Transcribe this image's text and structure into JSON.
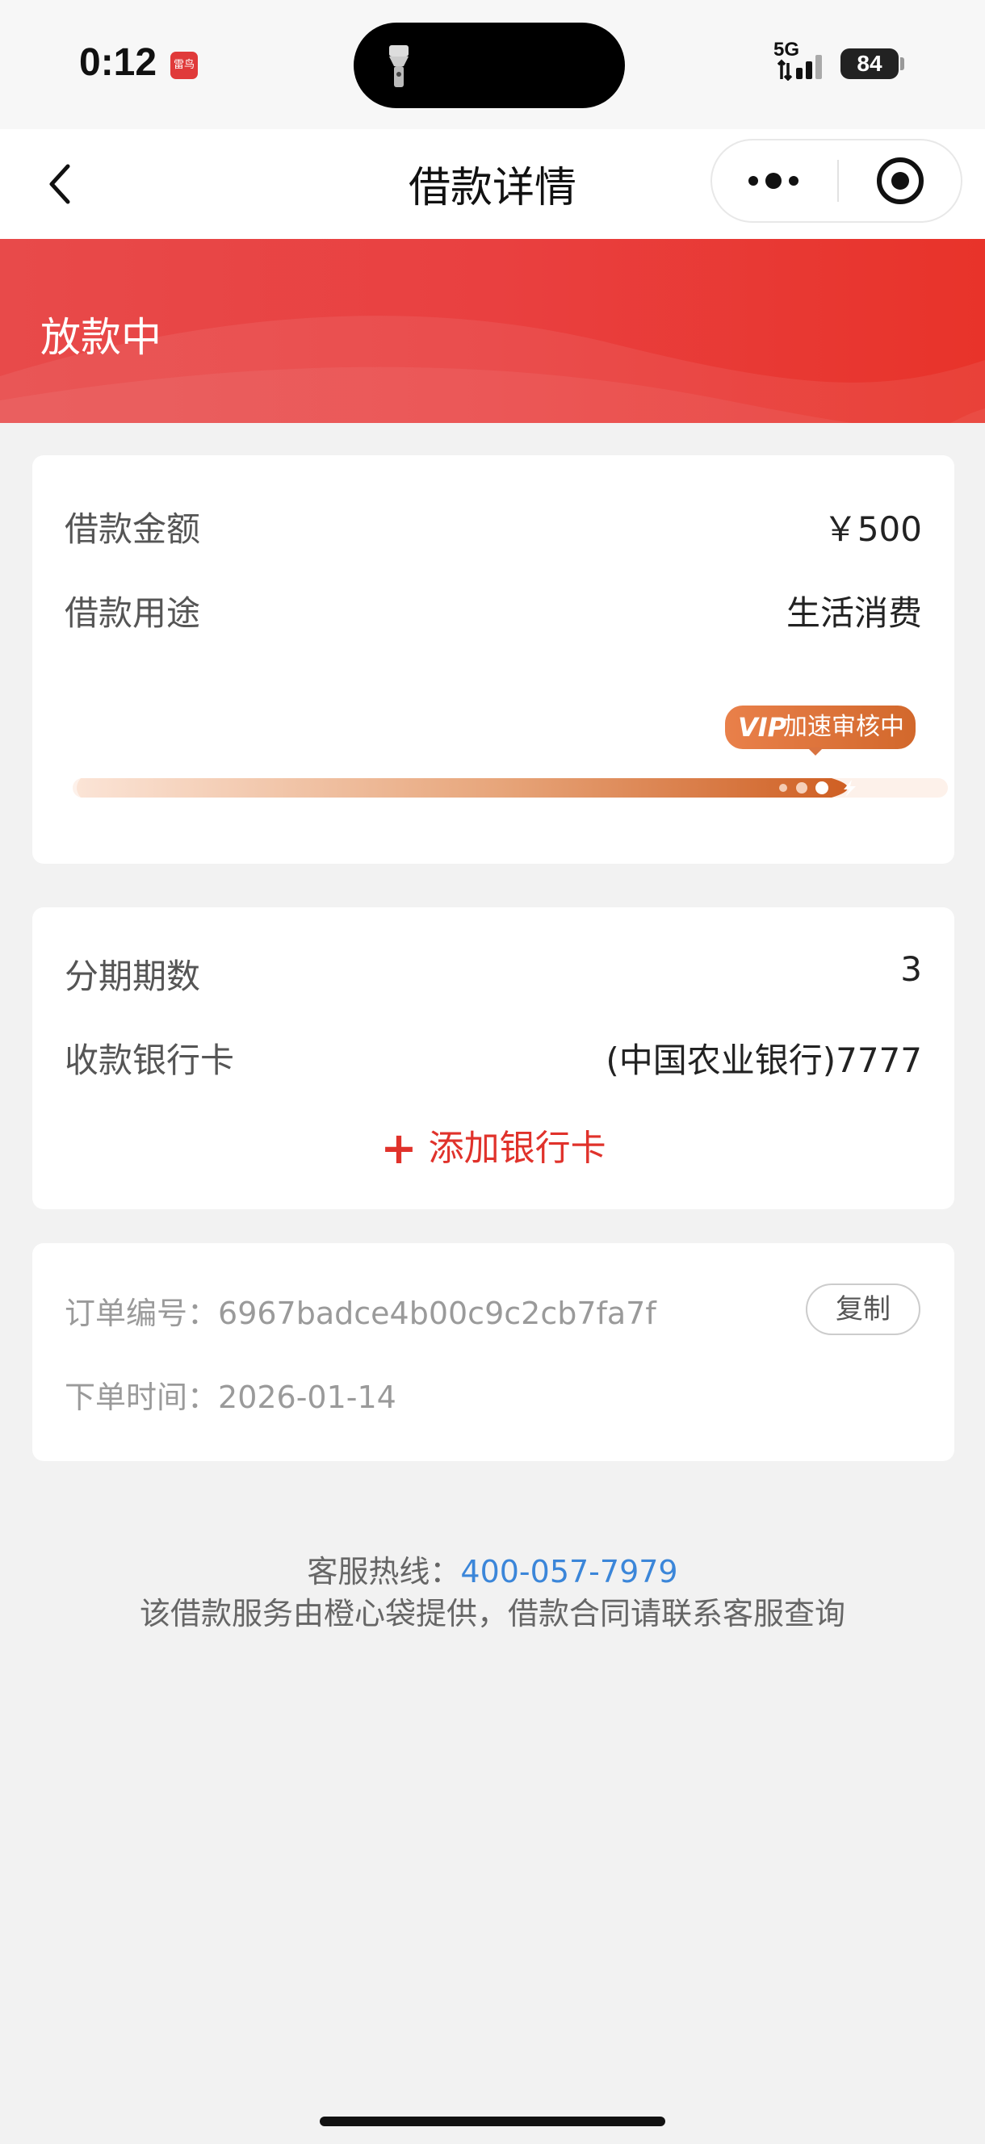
{
  "status_bar": {
    "time": "0:12",
    "app_badge": "雷鸟",
    "network": "5G",
    "battery": "84"
  },
  "nav": {
    "title": "借款详情"
  },
  "banner": {
    "status": "放款中"
  },
  "loan_info": {
    "amount_label": "借款金额",
    "amount_value": "￥500",
    "purpose_label": "借款用途",
    "purpose_value": "生活消费",
    "vip_badge_prefix": "VIP",
    "vip_badge_label": "加速审核中"
  },
  "installment_info": {
    "periods_label": "分期期数",
    "periods_value": "3",
    "bank_label": "收款银行卡",
    "bank_value": "(中国农业银行)7777",
    "add_card_plus": "+",
    "add_card_label": "添加银行卡"
  },
  "order_info": {
    "order_no_label": "订单编号：",
    "order_no_value": "6967badce4b00c9c2cb7fa7f",
    "copy_label": "复制",
    "order_time_label": "下单时间：",
    "order_time_value": "2026-01-14"
  },
  "footer": {
    "hotline_label": "客服热线：",
    "hotline_number": "400-057-7979",
    "notice": "该借款服务由橙心袋提供，借款合同请联系客服查询"
  },
  "colors": {
    "accent_red": "#e8332a",
    "vip_orange": "#d2682c",
    "link_blue": "#3b86d9"
  }
}
